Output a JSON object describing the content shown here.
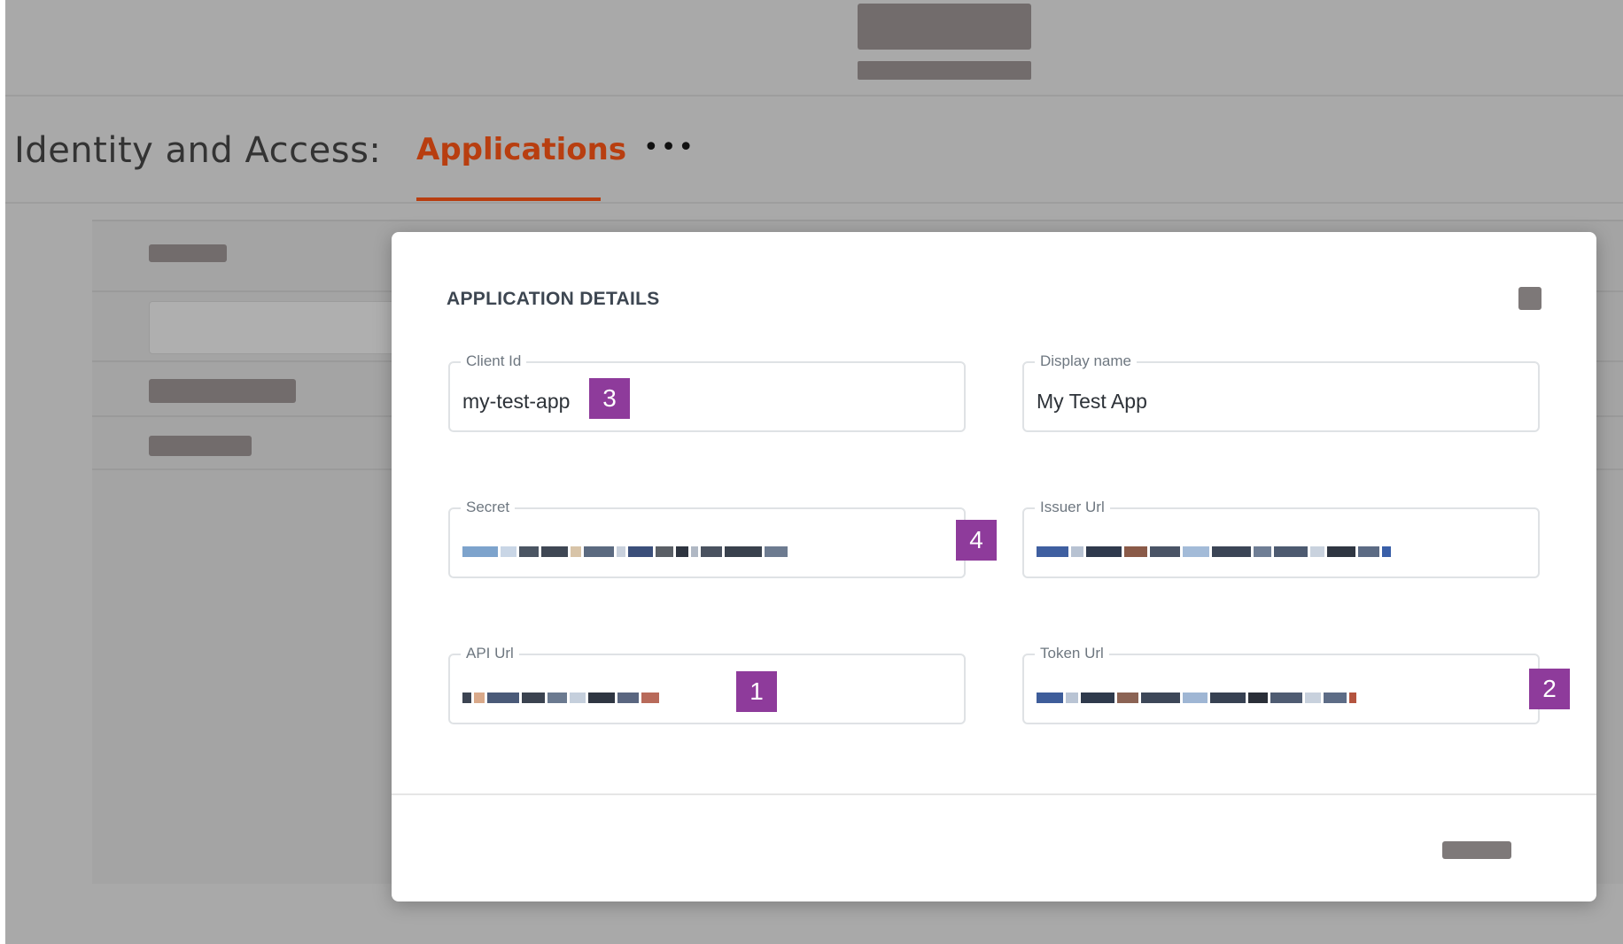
{
  "nav": {
    "section_title": "Identity and Access:",
    "active_tab": "Applications",
    "more": "•••"
  },
  "modal": {
    "title": "APPLICATION DETAILS",
    "fields": {
      "client_id": {
        "label": "Client Id",
        "value": "my-test-app"
      },
      "display_name": {
        "label": "Display name",
        "value": "My Test App"
      },
      "secret": {
        "label": "Secret"
      },
      "issuer_url": {
        "label": "Issuer Url"
      },
      "api_url": {
        "label": "API Url"
      },
      "token_url": {
        "label": "Token Url"
      }
    },
    "badges": {
      "api_url": "1",
      "token_url": "2",
      "client_id": "3",
      "secret": "4"
    }
  },
  "colors": {
    "accent": "#b83e10",
    "badge": "#8e3b9b",
    "overlay": "#a9a9a9"
  }
}
